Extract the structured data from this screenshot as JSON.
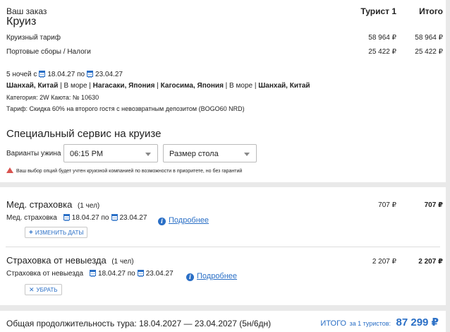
{
  "order": {
    "heading": "Ваш заказ",
    "col_tourist": "Турист 1",
    "col_total": "Итого",
    "title": "Круиз",
    "lines": [
      {
        "label": "Круизный тариф",
        "tourist": "58 964 ₽",
        "total": "58 964 ₽"
      },
      {
        "label": "Портовые сборы / Налоги",
        "tourist": "25 422 ₽",
        "total": "25 422 ₽"
      }
    ]
  },
  "cruise": {
    "nights_prefix": "5 ночей с",
    "date_from": "18.04.27",
    "date_sep": "по",
    "date_to": "23.04.27",
    "route": [
      {
        "text": "Шанхай, Китай",
        "bold": true
      },
      {
        "text": " | В море | ",
        "bold": false
      },
      {
        "text": "Нагасаки, Япония",
        "bold": true
      },
      {
        "text": " | ",
        "bold": false
      },
      {
        "text": "Кагосима, Япония",
        "bold": true
      },
      {
        "text": " | В море | ",
        "bold": false
      },
      {
        "text": "Шанхай, Китай",
        "bold": true
      }
    ],
    "category": "Категория: 2W   Каюта: № 10630",
    "tariff": "Тариф: Скидка 60% на второго гостя с невозвратным депозитом (BOGO60 NRD)"
  },
  "service": {
    "title": "Специальный сервис на круизе",
    "dinner_label": "Варианты ужина",
    "dinner_value": "06:15 PM",
    "table_value": "Размер стола",
    "warning": "Ваш выбор опций будет учтен круизной компанией по возможности в приоритете, но без гарантий"
  },
  "med": {
    "title": "Мед. страховка",
    "count": "(1 чел)",
    "tourist": "707 ₽",
    "total": "707 ₽",
    "label": "Мед. страховка",
    "date_from": "18.04.27",
    "date_sep": "по",
    "date_to": "23.04.27",
    "more": "Подробнее",
    "change_btn": "ИЗМЕНИТЬ ДАТЫ"
  },
  "cancel": {
    "title": "Страховка от невыезда",
    "count": "(1 чел)",
    "tourist": "2 207 ₽",
    "total": "2 207 ₽",
    "label": "Страховка от невыезда",
    "date_from": "18.04.27",
    "date_sep": "по",
    "date_to": "23.04.27",
    "more": "Подробнее",
    "remove_btn": "УБРАТЬ"
  },
  "footer": {
    "duration": "Общая продолжительность тура: 18.04.2027 — 23.04.2027 (5н/6дн)",
    "total_label": "ИТОГО",
    "total_for": "за 1 туристов:",
    "total_value": "87 299 ₽"
  }
}
